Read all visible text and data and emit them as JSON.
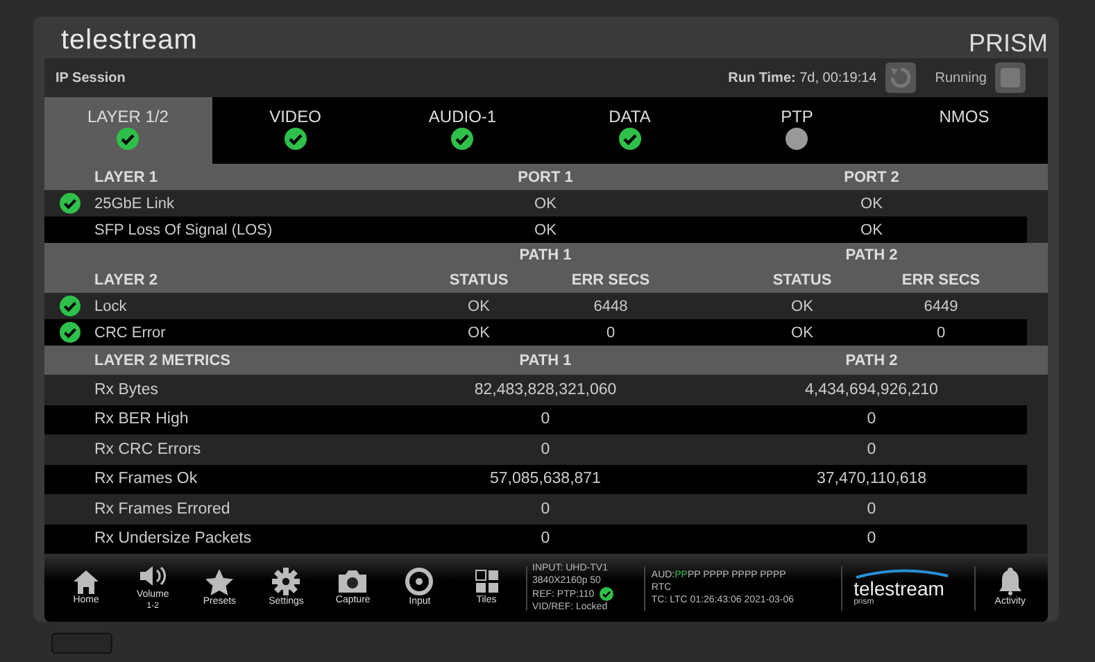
{
  "header": {
    "logo": "telestream",
    "product": "PRISM"
  },
  "session": {
    "title": "IP Session",
    "runtime_label": "Run Time:",
    "runtime": "7d, 00:19:14",
    "state": "Running"
  },
  "tabs": [
    {
      "label": "LAYER 1/2",
      "selected": true,
      "kind": "check"
    },
    {
      "label": "VIDEO",
      "selected": false,
      "kind": "check"
    },
    {
      "label": "AUDIO-1",
      "selected": false,
      "kind": "check"
    },
    {
      "label": "DATA",
      "selected": false,
      "kind": "check"
    },
    {
      "label": "PTP",
      "selected": false,
      "kind": "dot"
    },
    {
      "label": "NMOS",
      "selected": false,
      "kind": "plain"
    }
  ],
  "layer1": {
    "columns": [
      "LAYER 1",
      "PORT 1",
      "PORT 2"
    ],
    "rows": [
      {
        "ok": true,
        "name": "25GbE Link",
        "values": [
          "OK",
          "OK"
        ]
      },
      {
        "ok": false,
        "name": "SFP Loss Of Signal (LOS)",
        "values": [
          "OK",
          "OK"
        ]
      }
    ]
  },
  "layer2": {
    "groups": [
      "PATH 1",
      "PATH 2"
    ],
    "columns": [
      "LAYER 2",
      "STATUS",
      "ERR SECS",
      "STATUS",
      "ERR SECS"
    ],
    "rows": [
      {
        "ok": true,
        "name": "Lock",
        "values": [
          "OK",
          "6448",
          "OK",
          "6449"
        ]
      },
      {
        "ok": true,
        "name": "CRC Error",
        "values": [
          "OK",
          "0",
          "OK",
          "0"
        ]
      }
    ]
  },
  "metrics": {
    "columns": [
      "LAYER 2 METRICS",
      "PATH 1",
      "PATH 2"
    ],
    "rows": [
      {
        "name": "Rx Bytes",
        "values": [
          "82,483,828,321,060",
          "4,434,694,926,210"
        ]
      },
      {
        "name": "Rx BER High",
        "values": [
          "0",
          "0"
        ]
      },
      {
        "name": "Rx CRC Errors",
        "values": [
          "0",
          "0"
        ]
      },
      {
        "name": "Rx Frames Ok",
        "values": [
          "57,085,638,871",
          "37,470,110,618"
        ]
      },
      {
        "name": "Rx Frames Errored",
        "values": [
          "0",
          "0"
        ]
      },
      {
        "name": "Rx Undersize Packets",
        "values": [
          "0",
          "0"
        ]
      }
    ]
  },
  "toolbar": [
    {
      "kind": "home",
      "label": "Home"
    },
    {
      "kind": "volume",
      "label": "Volume",
      "sublabel": "1-2"
    },
    {
      "kind": "presets",
      "label": "Presets"
    },
    {
      "kind": "settings",
      "label": "Settings"
    },
    {
      "kind": "capture",
      "label": "Capture"
    },
    {
      "kind": "input",
      "label": "Input"
    },
    {
      "kind": "tiles",
      "label": "Tiles"
    }
  ],
  "input_status": {
    "lines": [
      "INPUT: UHD-TV1",
      "3840X2160p 50",
      "REF: PTP:110",
      "VID/REF: Locked"
    ],
    "ref_ok": true
  },
  "audio_status": {
    "label": "AUD:",
    "groups": [
      {
        "text": "PP",
        "active": true
      },
      {
        "text": "PP PPPP PPPP PPPP",
        "active": false
      }
    ],
    "rtc": "RTC",
    "tc": "TC: LTC 01:26:43:06 2021-03-06"
  },
  "brand": {
    "logo": "telestream",
    "product": "prism"
  },
  "activity": {
    "label": "Activity"
  }
}
